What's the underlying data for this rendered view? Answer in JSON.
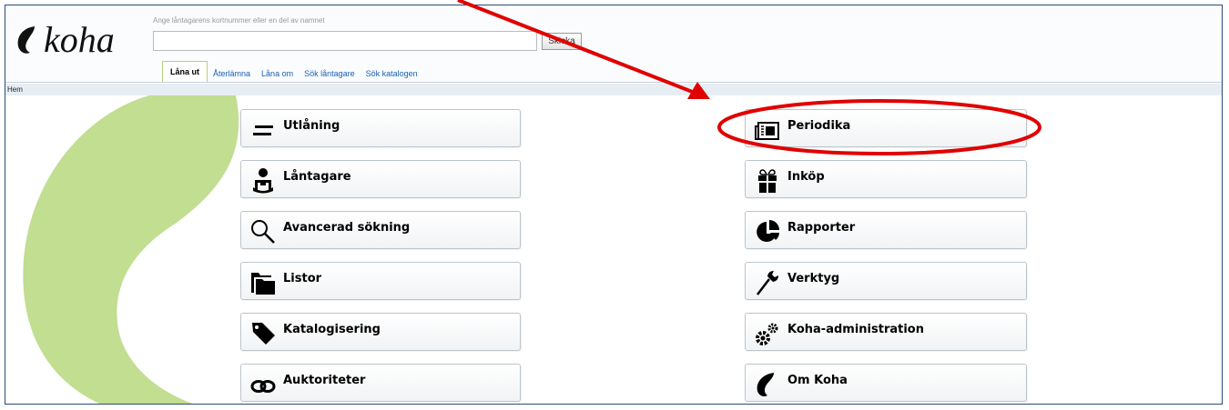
{
  "header": {
    "logo_text": "koha",
    "search_hint": "Ange låntagarens kortnummer eller en del av namnet",
    "search_value": "",
    "search_button": "Skicka",
    "tabs": [
      {
        "label": "Låna ut",
        "active": true
      },
      {
        "label": "Återlämna",
        "active": false
      },
      {
        "label": "Låna om",
        "active": false
      },
      {
        "label": "Sök låntagare",
        "active": false
      },
      {
        "label": "Sök katalogen",
        "active": false
      }
    ]
  },
  "breadcrumb": "Hem",
  "menu": {
    "left": [
      {
        "label": "Utlåning",
        "icon": "circulation-arrows-icon"
      },
      {
        "label": "Låntagare",
        "icon": "patron-icon"
      },
      {
        "label": "Avancerad sökning",
        "icon": "magnifier-icon"
      },
      {
        "label": "Listor",
        "icon": "folders-icon"
      },
      {
        "label": "Katalogisering",
        "icon": "tag-icon"
      },
      {
        "label": "Auktoriteter",
        "icon": "link-chain-icon"
      }
    ],
    "right": [
      {
        "label": "Periodika",
        "icon": "newspaper-icon"
      },
      {
        "label": "Inköp",
        "icon": "gift-icon"
      },
      {
        "label": "Rapporter",
        "icon": "pie-chart-icon"
      },
      {
        "label": "Verktyg",
        "icon": "wrench-icon"
      },
      {
        "label": "Koha-administration",
        "icon": "gears-icon"
      },
      {
        "label": "Om Koha",
        "icon": "koha-leaf-icon"
      }
    ]
  },
  "colors": {
    "accent_green": "#c1de91",
    "annotation_red": "#e00000",
    "link_blue": "#1a5fb4",
    "frame_border": "#2a4a7a"
  }
}
